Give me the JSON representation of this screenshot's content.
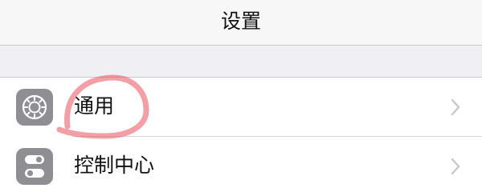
{
  "header": {
    "title": "设置"
  },
  "settings": {
    "items": [
      {
        "label": "通用",
        "icon": "gear-icon"
      },
      {
        "label": "控制中心",
        "icon": "toggle-switches-icon"
      }
    ]
  },
  "colors": {
    "icon_background": "#8e8e93",
    "annotation": "#e8525c",
    "chevron": "#c7c7cc"
  }
}
